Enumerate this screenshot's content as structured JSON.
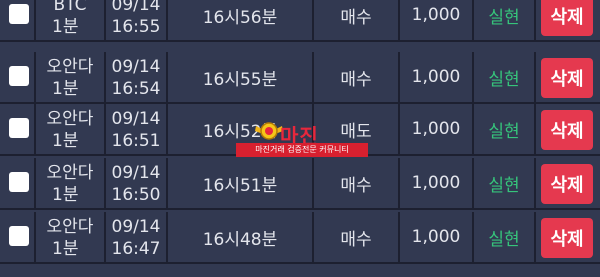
{
  "rows": [
    {
      "symbol_line1": "BTC",
      "symbol_line2": "1분",
      "date": "09/14",
      "time": "16:55",
      "round": "16시56분",
      "type": "매수",
      "amount": "1,000",
      "status": "실현",
      "delete_label": "삭제"
    },
    {
      "symbol_line1": "오안다",
      "symbol_line2": "1분",
      "date": "09/14",
      "time": "16:54",
      "round": "16시55분",
      "type": "매수",
      "amount": "1,000",
      "status": "실현",
      "delete_label": "삭제"
    },
    {
      "symbol_line1": "오안다",
      "symbol_line2": "1분",
      "date": "09/14",
      "time": "16:51",
      "round": "16시52분",
      "type": "매도",
      "amount": "1,000",
      "status": "실현",
      "delete_label": "삭제"
    },
    {
      "symbol_line1": "오안다",
      "symbol_line2": "1분",
      "date": "09/14",
      "time": "16:50",
      "round": "16시51분",
      "type": "매수",
      "amount": "1,000",
      "status": "실현",
      "delete_label": "삭제"
    },
    {
      "symbol_line1": "오안다",
      "symbol_line2": "1분",
      "date": "09/14",
      "time": "16:47",
      "round": "16시48분",
      "type": "매수",
      "amount": "1,000",
      "status": "실현",
      "delete_label": "삭제"
    }
  ],
  "watermark": {
    "title": "마진",
    "subtitle": "마진거래 검증전문 커뮤니티"
  },
  "colors": {
    "background": "#323951",
    "divider": "#1d2030",
    "text": "#e3e5ec",
    "status_green": "#36c47b",
    "delete_red": "#e5394f"
  }
}
